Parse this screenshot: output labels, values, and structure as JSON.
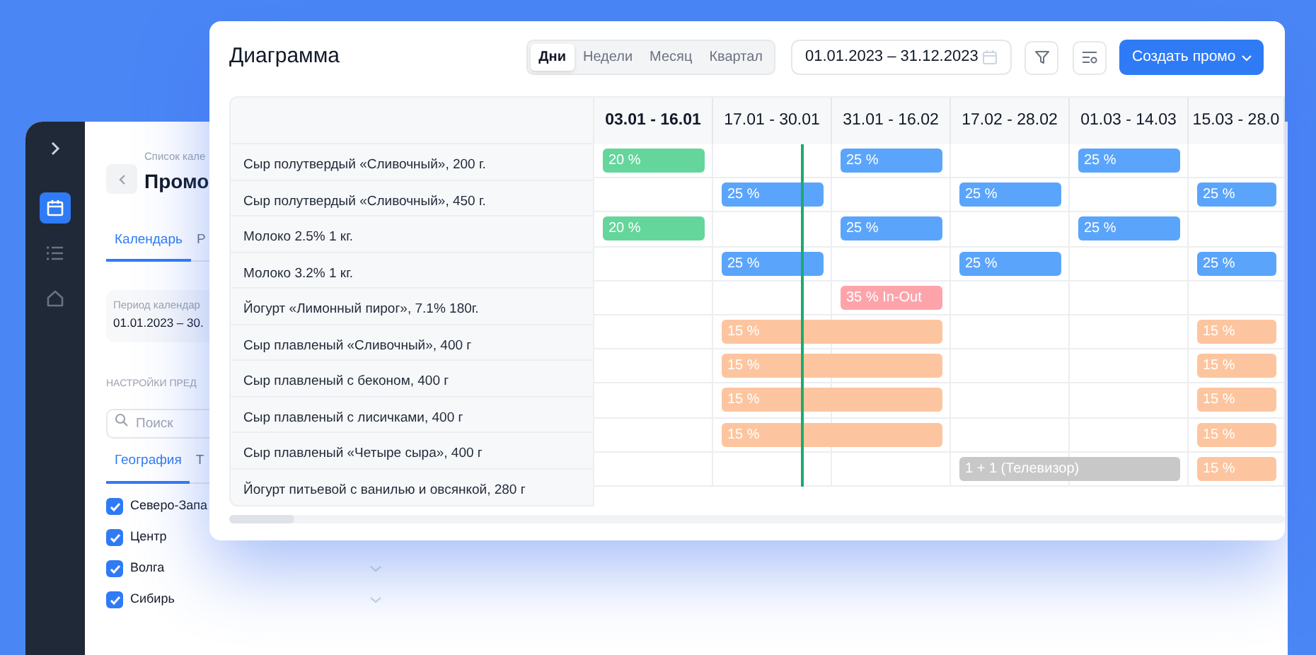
{
  "sidebar": {
    "items": [
      {
        "selected": true
      },
      {
        "selected": false
      },
      {
        "selected": false
      }
    ]
  },
  "back_window": {
    "breadcrumb": "Список кале",
    "title": "Промо",
    "tabs": [
      {
        "label": "Календарь",
        "selected": true
      },
      {
        "label": "Р",
        "selected": false
      }
    ],
    "period": {
      "label": "Период календар",
      "value": "01.01.2023 – 30."
    },
    "section_title": "НАСТРОЙКИ ПРЕД",
    "search": {
      "placeholder": "Поиск"
    },
    "filter_tabs": [
      {
        "label": "География",
        "selected": true
      },
      {
        "label": "Т",
        "selected": false
      }
    ],
    "regions": [
      {
        "label": "Северо-Запа",
        "checked": true,
        "expandable": false
      },
      {
        "label": "Центр",
        "checked": true,
        "expandable": false
      },
      {
        "label": "Волга",
        "checked": true,
        "expandable": true
      },
      {
        "label": "Сибирь",
        "checked": true,
        "expandable": true
      }
    ]
  },
  "card": {
    "title": "Диаграмма",
    "view_tabs": [
      {
        "label": "Дни",
        "selected": true
      },
      {
        "label": "Недели",
        "selected": false
      },
      {
        "label": "Месяц",
        "selected": false
      },
      {
        "label": "Квартал",
        "selected": false
      }
    ],
    "date_range": "01.01.2023 – 31.12.2023",
    "create_button": "Создать промо",
    "gantt": {
      "columns": [
        {
          "label": "03.01 - 16.01",
          "current": true
        },
        {
          "label": "17.01 - 30.01",
          "current": false
        },
        {
          "label": "31.01 - 16.02",
          "current": false
        },
        {
          "label": "17.02 - 28.02",
          "current": false
        },
        {
          "label": "01.03 - 14.03",
          "current": false
        },
        {
          "label": "15.03 - 28.0",
          "current": false
        }
      ],
      "rows": [
        {
          "label": "Сыр полутвердый «Сливочный», 200 г.",
          "cells": [
            {
              "kind": "bar",
              "label": "20 %",
              "color": "#65d69b",
              "wide": false
            },
            {
              "kind": "empty"
            },
            {
              "kind": "bar",
              "label": "25 %",
              "color": "#5aa5fb",
              "wide": false
            },
            {
              "kind": "empty"
            },
            {
              "kind": "bar",
              "label": "25 %",
              "color": "#5aa5fb",
              "wide": false
            },
            {
              "kind": "empty"
            }
          ]
        },
        {
          "label": "Сыр полутвердый «Сливочный», 450 г.",
          "cells": [
            {
              "kind": "empty"
            },
            {
              "kind": "bar",
              "label": "25 %",
              "color": "#5aa5fb",
              "wide": false
            },
            {
              "kind": "empty"
            },
            {
              "kind": "bar",
              "label": "25 %",
              "color": "#5aa5fb",
              "wide": false
            },
            {
              "kind": "empty"
            },
            {
              "kind": "bar",
              "label": "25 %",
              "color": "#5aa5fb",
              "wide": false
            }
          ]
        },
        {
          "label": "Молоко 2.5% 1 кг.",
          "cells": [
            {
              "kind": "bar",
              "label": "20 %",
              "color": "#65d69b",
              "wide": false
            },
            {
              "kind": "empty"
            },
            {
              "kind": "bar",
              "label": "25 %",
              "color": "#5aa5fb",
              "wide": false
            },
            {
              "kind": "empty"
            },
            {
              "kind": "bar",
              "label": "25 %",
              "color": "#5aa5fb",
              "wide": false
            },
            {
              "kind": "empty"
            }
          ]
        },
        {
          "label": "Молоко 3.2% 1 кг.",
          "cells": [
            {
              "kind": "empty"
            },
            {
              "kind": "bar",
              "label": "25 %",
              "color": "#5aa5fb",
              "wide": false
            },
            {
              "kind": "empty"
            },
            {
              "kind": "bar",
              "label": "25 %",
              "color": "#5aa5fb",
              "wide": false
            },
            {
              "kind": "empty"
            },
            {
              "kind": "bar",
              "label": "25 %",
              "color": "#5aa5fb",
              "wide": false
            }
          ]
        },
        {
          "label": "Йогурт «Лимонный пирог», 7.1% 180г.",
          "cells": [
            {
              "kind": "empty"
            },
            {
              "kind": "empty"
            },
            {
              "kind": "bar",
              "label": "35 % In-Out",
              "color": "#fda4ab",
              "wide": false
            },
            {
              "kind": "empty"
            },
            {
              "kind": "empty"
            },
            {
              "kind": "empty"
            }
          ]
        },
        {
          "label": "Сыр плавленый «Сливочный», 400 г",
          "cells": [
            {
              "kind": "empty"
            },
            {
              "kind": "bar",
              "label": "15 %",
              "color": "#fdc59f",
              "wide": true
            },
            {
              "kind": "empty"
            },
            {
              "kind": "empty"
            },
            {
              "kind": "bar",
              "label": "15 %",
              "color": "#fdc59f",
              "wide": false
            }
          ]
        },
        {
          "label": "Сыр плавленый с беконом, 400 г",
          "cells": [
            {
              "kind": "empty"
            },
            {
              "kind": "bar",
              "label": "15 %",
              "color": "#fdc59f",
              "wide": true
            },
            {
              "kind": "empty"
            },
            {
              "kind": "empty"
            },
            {
              "kind": "bar",
              "label": "15 %",
              "color": "#fdc59f",
              "wide": false
            }
          ]
        },
        {
          "label": "Сыр плавленый с лисичками, 400 г",
          "cells": [
            {
              "kind": "empty"
            },
            {
              "kind": "bar",
              "label": "15 %",
              "color": "#fdc59f",
              "wide": true
            },
            {
              "kind": "empty"
            },
            {
              "kind": "empty"
            },
            {
              "kind": "bar",
              "label": "15 %",
              "color": "#fdc59f",
              "wide": false
            }
          ]
        },
        {
          "label": "Сыр плавленый «Четыре сыра», 400 г",
          "cells": [
            {
              "kind": "empty"
            },
            {
              "kind": "bar",
              "label": "15 %",
              "color": "#fdc59f",
              "wide": true
            },
            {
              "kind": "empty"
            },
            {
              "kind": "empty"
            },
            {
              "kind": "bar",
              "label": "15 %",
              "color": "#fdc59f",
              "wide": false
            }
          ]
        },
        {
          "label": "Йогурт питьевой с ванилью и овсянкой, 280 г",
          "cells": [
            {
              "kind": "empty"
            },
            {
              "kind": "empty"
            },
            {
              "kind": "empty"
            },
            {
              "kind": "bar",
              "label": "1 + 1 (Телевизор)",
              "color": "#c8c8c8",
              "wide": true
            },
            {
              "kind": "bar",
              "label": "15 %",
              "color": "#fdc59f",
              "wide": false
            }
          ]
        }
      ]
    }
  }
}
